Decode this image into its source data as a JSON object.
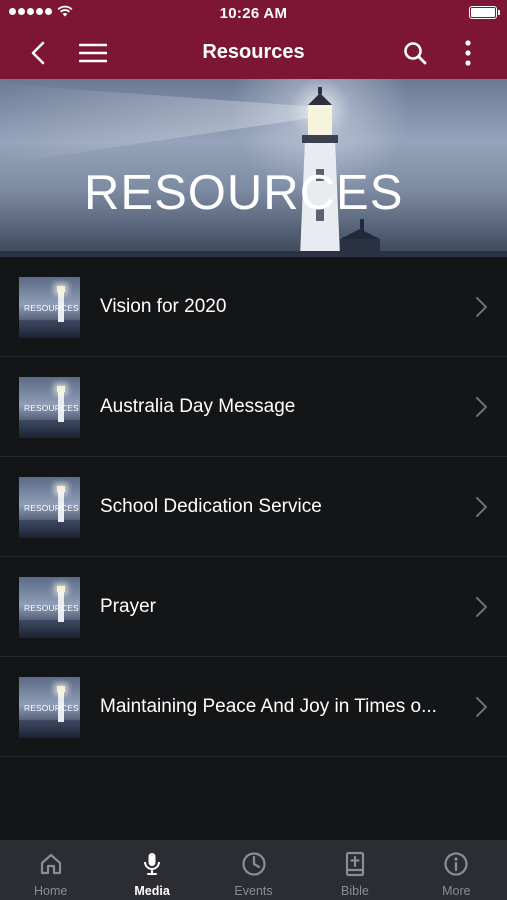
{
  "status_bar": {
    "time": "10:26 AM"
  },
  "nav": {
    "title": "Resources"
  },
  "banner": {
    "text": "RESOURCES"
  },
  "resources": [
    {
      "title": "Vision for 2020",
      "thumb_text": "RESOURCES"
    },
    {
      "title": "Australia Day Message",
      "thumb_text": "RESOURCES"
    },
    {
      "title": "School Dedication Service",
      "thumb_text": "RESOURCES"
    },
    {
      "title": "Prayer",
      "thumb_text": "RESOURCES"
    },
    {
      "title": "Maintaining Peace And Joy in Times o...",
      "thumb_text": "RESOURCES"
    }
  ],
  "tabs": [
    {
      "label": "Home",
      "icon": "home-icon"
    },
    {
      "label": "Media",
      "icon": "microphone-icon",
      "active": true
    },
    {
      "label": "Events",
      "icon": "clock-icon"
    },
    {
      "label": "Bible",
      "icon": "bible-icon"
    },
    {
      "label": "More",
      "icon": "info-icon"
    }
  ],
  "colors": {
    "nav_background": "#7d1534",
    "list_background": "#141517",
    "tabbar_background": "#2b2d32",
    "inactive_tab": "#8a8d94"
  }
}
